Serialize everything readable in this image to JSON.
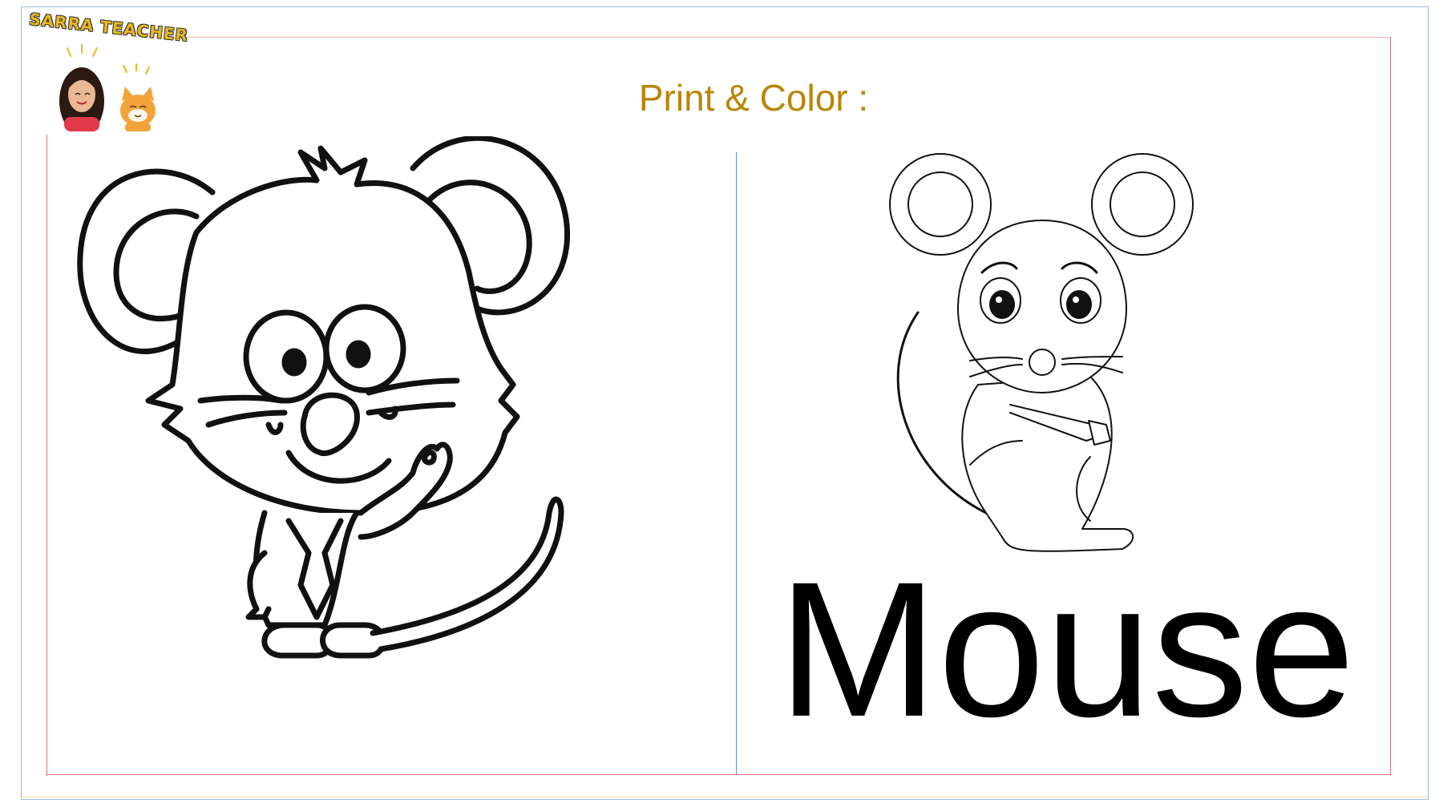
{
  "header": {
    "logo_text": "SARRA TEACHER",
    "title": "Print & Color :"
  },
  "main": {
    "word": "Mouse"
  },
  "colors": {
    "title": "#b8860b",
    "logo_text": "#e8b722",
    "divider": "#5a8ec7",
    "frame": "#e0707a"
  }
}
